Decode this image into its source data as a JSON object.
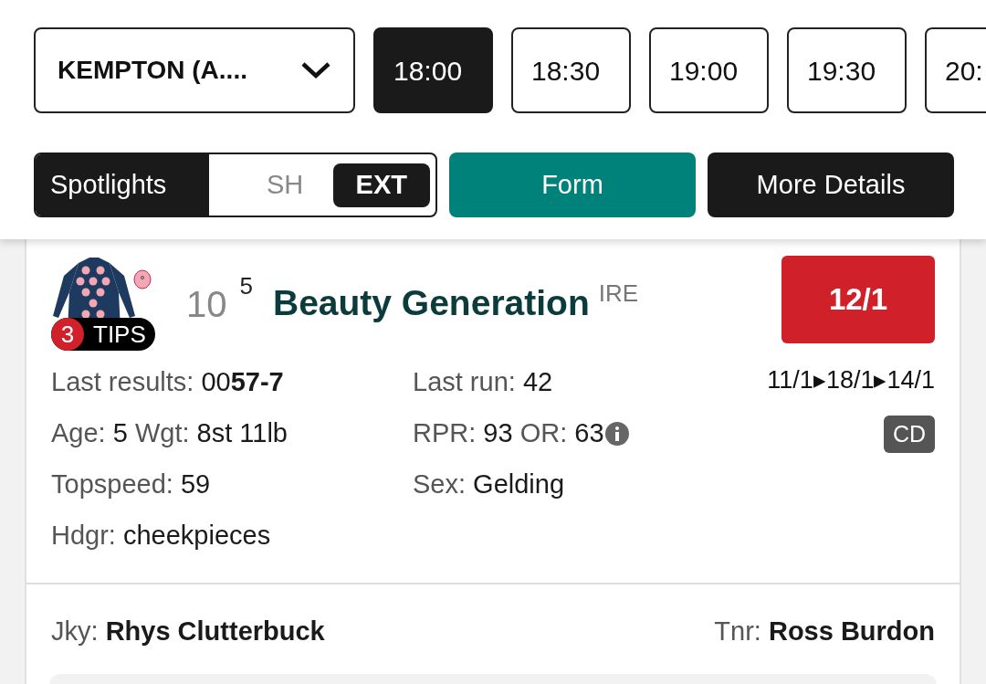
{
  "meeting_select": {
    "value": "KEMPTON (A...."
  },
  "race_times": [
    {
      "label": "18:00",
      "selected": true
    },
    {
      "label": "18:30",
      "selected": false
    },
    {
      "label": "19:00",
      "selected": false
    },
    {
      "label": "19:30",
      "selected": false
    },
    {
      "label": "20:",
      "selected": false
    }
  ],
  "view_toggle": {
    "label": "Spotlights",
    "options": [
      {
        "label": "SH",
        "selected": false
      },
      {
        "label": "EXT",
        "selected": true
      }
    ]
  },
  "tabs": [
    {
      "label": "Form",
      "selected": true
    },
    {
      "label": "More Details",
      "selected": false
    }
  ],
  "runner": {
    "tips": {
      "count": "3",
      "label": "TIPS"
    },
    "number": "10",
    "draw": "5",
    "name": "Beauty Generation",
    "country": "IRE",
    "odds": "12/1",
    "odds_history": "11/1▸18/1▸14/1",
    "badge": "CD",
    "stats_left": [
      {
        "pairs": [
          {
            "label": "Last results:",
            "value": "00**57-7**"
          }
        ]
      },
      {
        "pairs": [
          {
            "label": "Age:",
            "value": "5"
          },
          {
            "label": "Wgt:",
            "value": "8st 11lb"
          }
        ]
      },
      {
        "pairs": [
          {
            "label": "Topspeed:",
            "value": "59"
          }
        ]
      },
      {
        "pairs": [
          {
            "label": "Hdgr:",
            "value": "cheekpieces"
          }
        ]
      }
    ],
    "stats_right": [
      {
        "pairs": [
          {
            "label": "Last run:",
            "value": "42"
          }
        ]
      },
      {
        "kind": "rating",
        "pairs": [
          {
            "label": "RPR:",
            "value": "93"
          },
          {
            "label": "OR:",
            "value": "63"
          }
        ]
      },
      {
        "pairs": [
          {
            "label": "Sex:",
            "value": "Gelding"
          }
        ]
      }
    ],
    "jockey": {
      "label": "Jky:",
      "value": "Rhys Clutterbuck"
    },
    "trainer": {
      "label": "Tnr:",
      "value": "Ross Burdon"
    }
  }
}
